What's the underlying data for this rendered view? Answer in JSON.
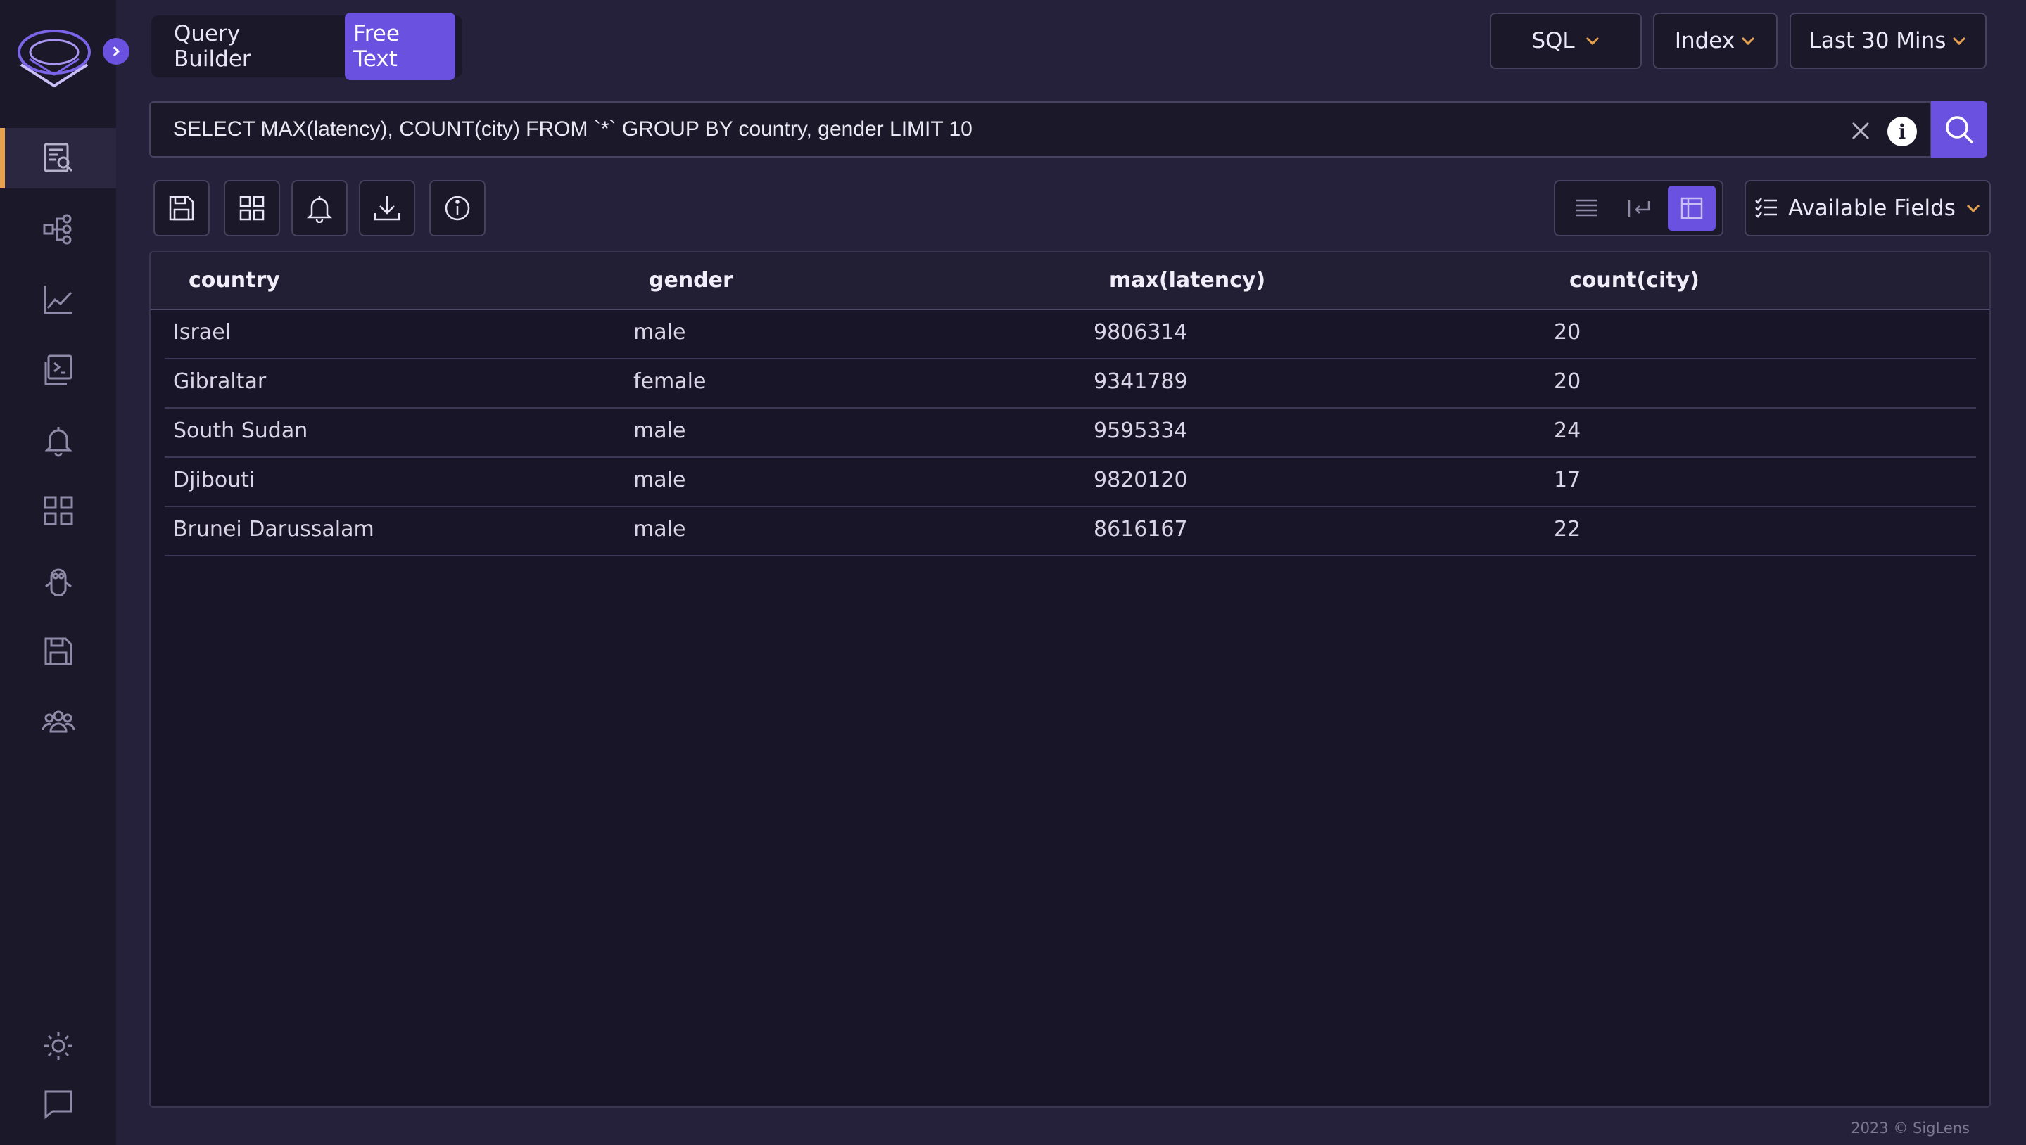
{
  "mode_toggle": {
    "options": [
      "Query Builder",
      "Free Text"
    ],
    "active": "Free Text"
  },
  "header": {
    "query_language": "SQL",
    "index_label": "Index",
    "time_range": "Last 30 Mins"
  },
  "search": {
    "query": "SELECT MAX(latency), COUNT(city) FROM `*` GROUP BY country, gender LIMIT 10",
    "info_label": "i"
  },
  "toolbar": {
    "available_fields_label": "Available Fields"
  },
  "table": {
    "columns": [
      "country",
      "gender",
      "max(latency)",
      "count(city)"
    ],
    "rows": [
      [
        "Israel",
        "male",
        "9806314",
        "20"
      ],
      [
        "Gibraltar",
        "female",
        "9341789",
        "20"
      ],
      [
        "South Sudan",
        "male",
        "9595334",
        "24"
      ],
      [
        "Djibouti",
        "male",
        "9820120",
        "17"
      ],
      [
        "Brunei Darussalam",
        "male",
        "8616167",
        "22"
      ]
    ]
  },
  "footer": {
    "text": "2023 © SigLens"
  },
  "colors": {
    "accent": "#6a51e0",
    "active_marker": "#e7a250",
    "background": "#25213a",
    "sidebar": "#1b1829"
  },
  "icons": {
    "sidebar": [
      "logs-search-icon",
      "service-graph-icon",
      "metrics-chart-icon",
      "dashboard-terminal-icon",
      "alert-bell-icon",
      "grid-apps-icon",
      "penguin-icon",
      "save-disk-icon",
      "users-group-icon",
      "sun-theme-icon",
      "chat-feedback-icon"
    ],
    "toolbar": [
      "save-icon",
      "grid-icon",
      "bell-icon",
      "download-icon",
      "info-icon"
    ]
  }
}
